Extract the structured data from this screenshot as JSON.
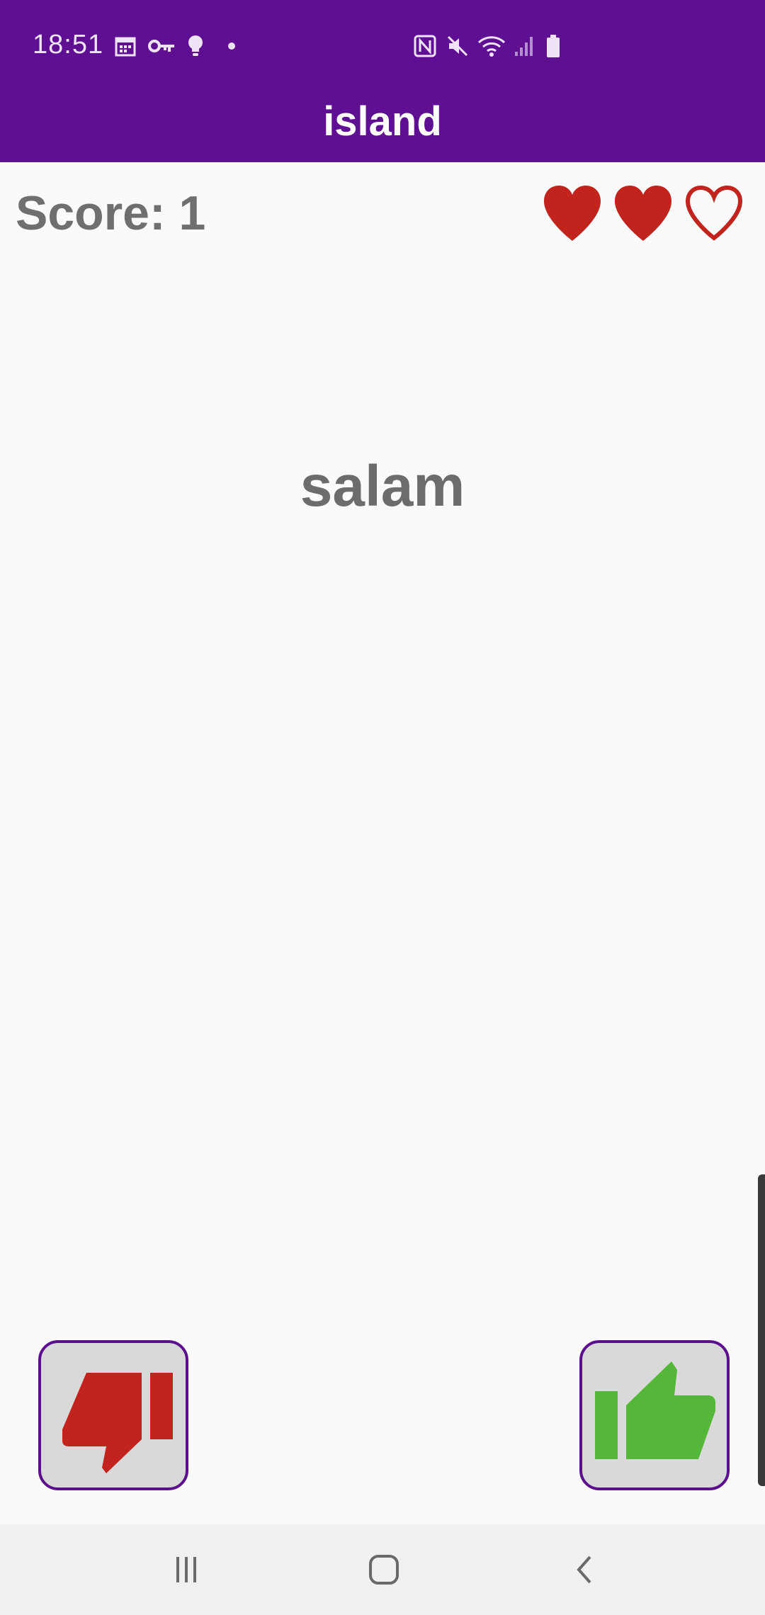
{
  "status_bar": {
    "time": "18:51",
    "left_icons": [
      "calendar-icon",
      "key-icon",
      "lightbulb-icon",
      "dot-icon"
    ],
    "right_icons": [
      "nfc-icon",
      "mute-icon",
      "wifi-icon",
      "signal-icon",
      "battery-icon"
    ]
  },
  "app_bar": {
    "title": "island",
    "color": "#5f0f91"
  },
  "game": {
    "score_label": "Score: 1",
    "lives_total": 3,
    "lives_remaining": 2,
    "heart_color": "#c0241c",
    "word": "salam"
  },
  "buttons": {
    "dislike": {
      "icon": "thumbs-down-icon",
      "color": "#c0241c"
    },
    "like": {
      "icon": "thumbs-up-icon",
      "color": "#55b73a"
    },
    "border_color": "#5b0f8c"
  },
  "nav_bar": {
    "buttons": [
      "recent-apps-icon",
      "home-icon",
      "back-icon"
    ]
  }
}
